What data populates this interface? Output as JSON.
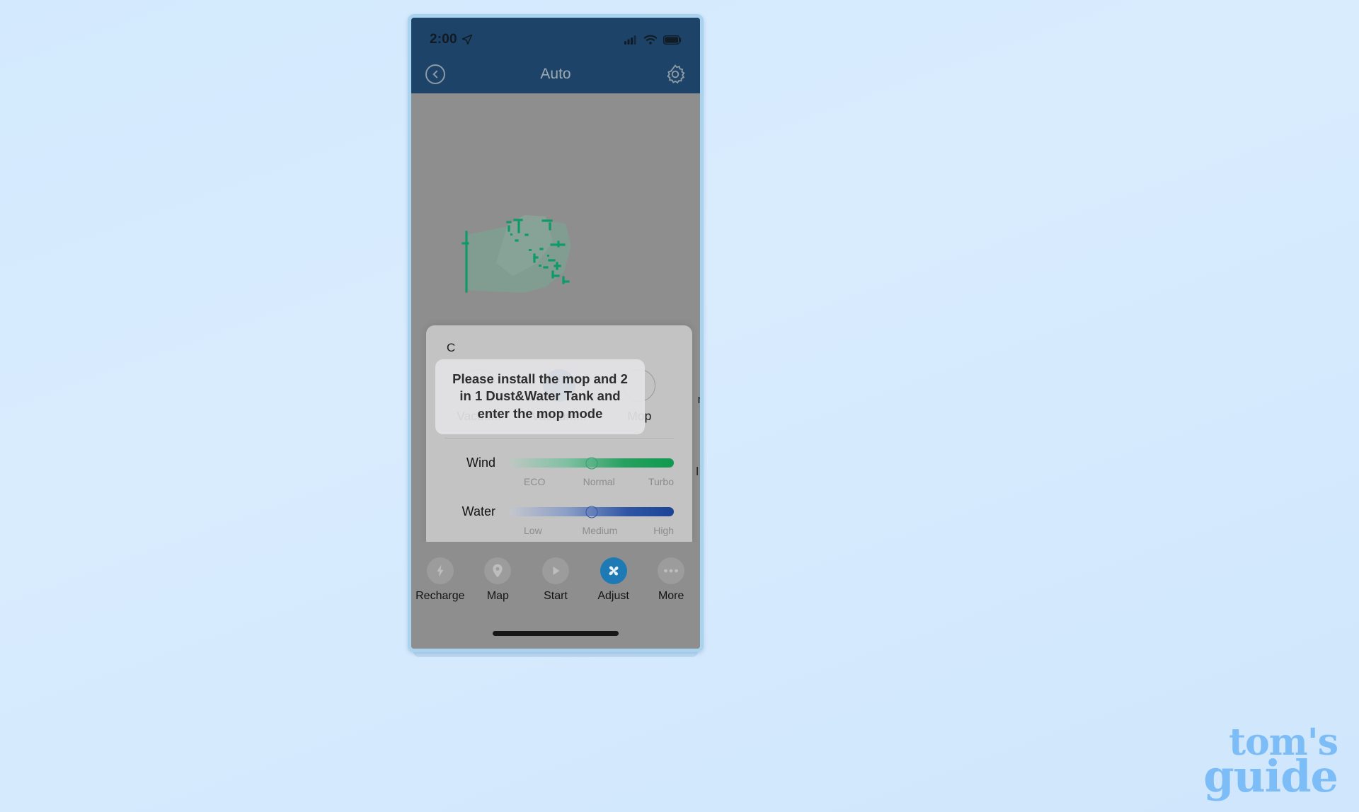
{
  "status_bar": {
    "time": "2:00",
    "location_icon": "location-arrow-icon",
    "cellular_icon": "cellular-signal-icon",
    "wifi_icon": "wifi-icon",
    "battery_icon": "battery-full-icon"
  },
  "app_header": {
    "back_icon": "back-chevron-icon",
    "title": "Auto",
    "settings_icon": "gear-icon"
  },
  "map": {
    "occluded_text_right_1": "n",
    "occluded_text_right_2": "l",
    "plan_color": "#7d9e91",
    "plan_outline_color": "#0f9a6a"
  },
  "toast": {
    "message": "Please install the mop and 2 in 1 Dust&Water Tank and enter the mop mode"
  },
  "adjust_panel": {
    "title": "C",
    "modes": [
      {
        "label": "Vacuum",
        "selected": false
      },
      {
        "label": "Vacuum...",
        "selected": true
      },
      {
        "label": "Mop",
        "selected": false
      }
    ],
    "wind": {
      "label": "Wind",
      "value_percent": 50,
      "ticks": [
        "ECO",
        "Normal",
        "Turbo"
      ],
      "accent": "#0f9a4f"
    },
    "water": {
      "label": "Water",
      "value_percent": 50,
      "ticks": [
        "Low",
        "Medium",
        "High"
      ],
      "accent": "#1c4396"
    }
  },
  "tab_bar": [
    {
      "label": "Recharge",
      "icon": "lightning-bolt-icon",
      "active": false
    },
    {
      "label": "Map",
      "icon": "location-pin-icon",
      "active": false
    },
    {
      "label": "Start",
      "icon": "play-icon",
      "active": false
    },
    {
      "label": "Adjust",
      "icon": "fan-icon",
      "active": true
    },
    {
      "label": "More",
      "icon": "ellipsis-icon",
      "active": false
    }
  ],
  "watermark": {
    "line1": "tom's",
    "line2": "guide"
  }
}
